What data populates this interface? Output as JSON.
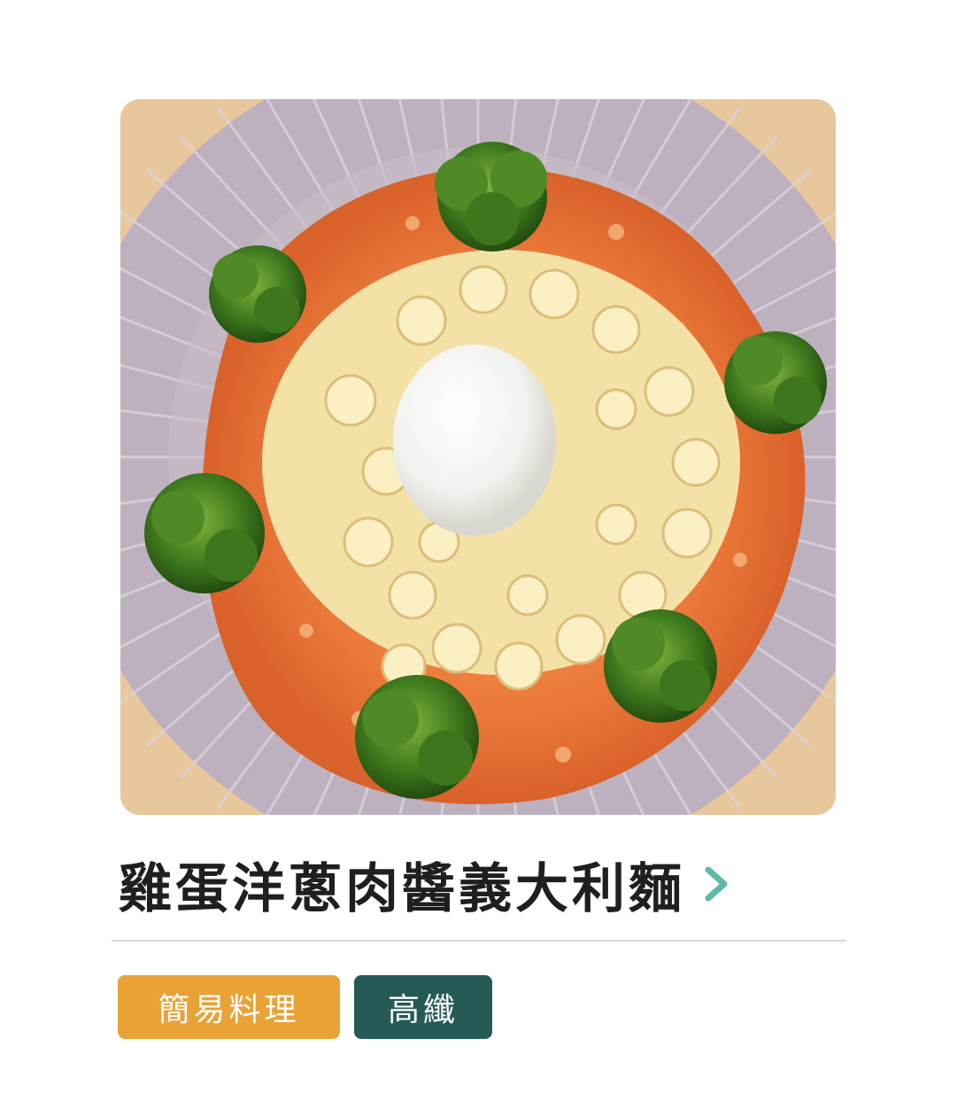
{
  "recipe": {
    "title": "雞蛋洋蔥肉醬義大利麵",
    "chevron_icon": "chevron-right-icon",
    "photo_icon": "food-photo"
  },
  "tags": [
    {
      "label": "簡易料理",
      "color": "#e9a236"
    },
    {
      "label": "高纖",
      "color": "#265a57"
    }
  ],
  "colors": {
    "title": "#1f1f1f",
    "chevron": "#5fb8a8",
    "divider": "#d6d6d6"
  }
}
